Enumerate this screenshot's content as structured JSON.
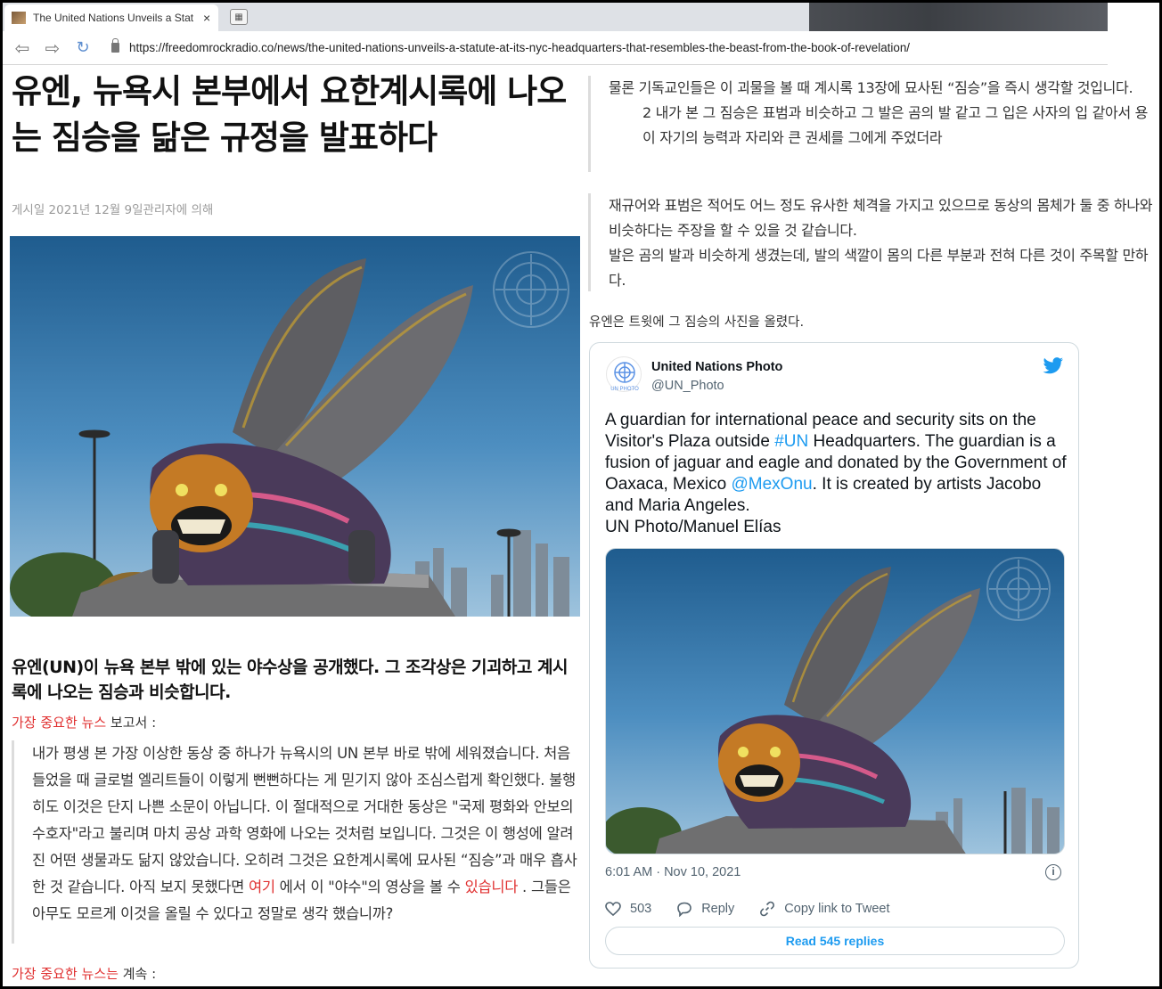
{
  "browser": {
    "tab_title": "The United Nations Unveils a Stat",
    "tab_close": "×",
    "new_tab_icon": "tab-grid-icon",
    "url": "https://freedomrockradio.co/news/the-united-nations-unveils-a-statute-at-its-nyc-headquarters-that-resembles-the-beast-from-the-book-of-revelation/"
  },
  "article": {
    "headline": "유엔, 뉴욕시 본부에서 요한계시록에 나오는 짐승을 닮은 규정을 발표하다",
    "byline": "게시일 2021년 12월 9일관리자에 의해",
    "subhead": "유엔(UN)이 뉴욕 본부 밖에 있는 야수상을 공개했다. 그 조각상은 기괴하고 계시록에 나오는 짐승과 비슷합니다.",
    "source1": {
      "link": "가장 중요한 뉴스",
      "rest": " 보고서 :"
    },
    "quote": {
      "part1": "내가 평생 본 가장 이상한 동상 중 하나가 뉴욕시의 UN 본부 바로 밖에 세워졌습니다. 처음 들었을 때 글로벌 엘리트들이 이렇게 뻔뻔하다는 게 믿기지 않아 조심스럽게 확인했다. 불행히도 이것은 단지 나쁜 소문이 아닙니다. 이 절대적으로 거대한 동상은 \"국제 평화와 안보의 수호자\"라고 불리며 마치 공상 과학 영화에 나오는 것처럼 보입니다. 그것은 이 행성에 알려진 어떤 생물과도 닮지 않았습니다. 오히려 그것은 요한계시록에 묘사된 “짐승”과 매우 흡사한 것 같습니다. 아직 보지 못했다면 ",
      "link1": "여기",
      "part2": " 에서 이 \"야수\"의 영상을 볼 수 ",
      "link2": "있습니다",
      "part3": " . 그들은 아무도 모르게 이것을 올릴 수 있다고 정말로 생각 했습니까?"
    },
    "source2": {
      "link": "가장 중요한 뉴스는",
      "rest": " 계속 :"
    },
    "right_quote1": {
      "line1": "물론 기독교인들은 이 괴물을 볼 때 계시록 13장에 묘사된 “짐승”을 즉시 생각할 것입니다.",
      "line2": "2 내가 본 그 짐승은 표범과 비슷하고 그 발은 곰의 발 같고 그 입은 사자의 입 같아서 용이 자기의 능력과 자리와 큰 권세를 그에게 주었더라"
    },
    "right_quote2": {
      "line1": "재규어와 표범은 적어도 어느 정도 유사한 체격을 가지고 있으므로 동상의 몸체가 둘 중 하나와 비슷하다는 주장을 할 수 있을 것 같습니다.",
      "line2": "발은 곰의 발과 비슷하게 생겼는데, 발의 색깔이 몸의 다른 부분과 전혀 다른 것이 주목할 만하다."
    },
    "tweet_intro": "유엔은 트윗에 그 짐승의 사진을 올렸다."
  },
  "tweet": {
    "name": "United Nations Photo",
    "handle": "@UN_Photo",
    "text_a": "A guardian for international peace and security sits on the Visitor's Plaza outside ",
    "hashtag": "#UN",
    "text_b": " Headquarters. The guardian is a fusion of jaguar and eagle and donated by the Government of Oaxaca, Mexico ",
    "mention": "@MexOnu",
    "text_c": ". It is created by artists Jacobo and Maria Angeles.",
    "text_d": "UN Photo/Manuel Elías",
    "timestamp": "6:01 AM · Nov 10, 2021",
    "likes": "503",
    "reply_label": "Reply",
    "copy_label": "Copy link to Tweet",
    "replies_button": "Read 545 replies",
    "avatar_caption": "UN PHOTO"
  },
  "colors": {
    "link_red": "#e03030",
    "twitter_blue": "#1d9bf0"
  }
}
